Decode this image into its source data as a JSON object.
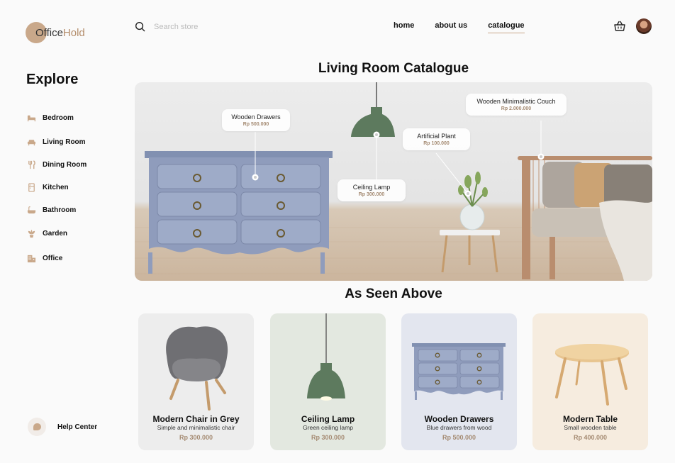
{
  "brand": {
    "part1": "Office",
    "part2": "Hold"
  },
  "search": {
    "placeholder": "Search store"
  },
  "nav": [
    {
      "label": "home",
      "active": false
    },
    {
      "label": "about us",
      "active": false
    },
    {
      "label": "catalogue",
      "active": true
    }
  ],
  "sidebar": {
    "heading": "Explore",
    "items": [
      {
        "label": "Bedroom",
        "icon": "bed-icon"
      },
      {
        "label": "Living Room",
        "icon": "sofa-icon"
      },
      {
        "label": "Dining Room",
        "icon": "cutlery-icon"
      },
      {
        "label": "Kitchen",
        "icon": "fridge-icon"
      },
      {
        "label": "Bathroom",
        "icon": "bathtub-icon"
      },
      {
        "label": "Garden",
        "icon": "plant-icon"
      },
      {
        "label": "Office",
        "icon": "building-icon"
      }
    ],
    "help": "Help Center"
  },
  "hero": {
    "title": "Living Room Catalogue",
    "tags": [
      {
        "name": "Wooden Drawers",
        "price": "Rp 500.000"
      },
      {
        "name": "Ceiling Lamp",
        "price": "Rp 300.000"
      },
      {
        "name": "Artificial Plant",
        "price": "Rp 100.000"
      },
      {
        "name": "Wooden Minimalistic Couch",
        "price": "Rp 2.000.000"
      }
    ]
  },
  "section": {
    "title": "As Seen Above"
  },
  "products": [
    {
      "name": "Modern Chair in Grey",
      "desc": "Simple and minimalistic chair",
      "price": "Rp 300.000",
      "bg": "#ededed"
    },
    {
      "name": "Ceiling Lamp",
      "desc": "Green ceiling lamp",
      "price": "Rp 300.000",
      "bg": "#e3e8e0"
    },
    {
      "name": "Wooden Drawers",
      "desc": "Blue drawers from wood",
      "price": "Rp 500.000",
      "bg": "#e3e6ef"
    },
    {
      "name": "Modern Table",
      "desc": "Small wooden table",
      "price": "Rp 400.000",
      "bg": "#f6ecdf"
    }
  ],
  "colors": {
    "accent": "#c9a88a",
    "price": "#a58b73",
    "drawer": "#8f9cbc",
    "lamp": "#5d7a5e"
  }
}
